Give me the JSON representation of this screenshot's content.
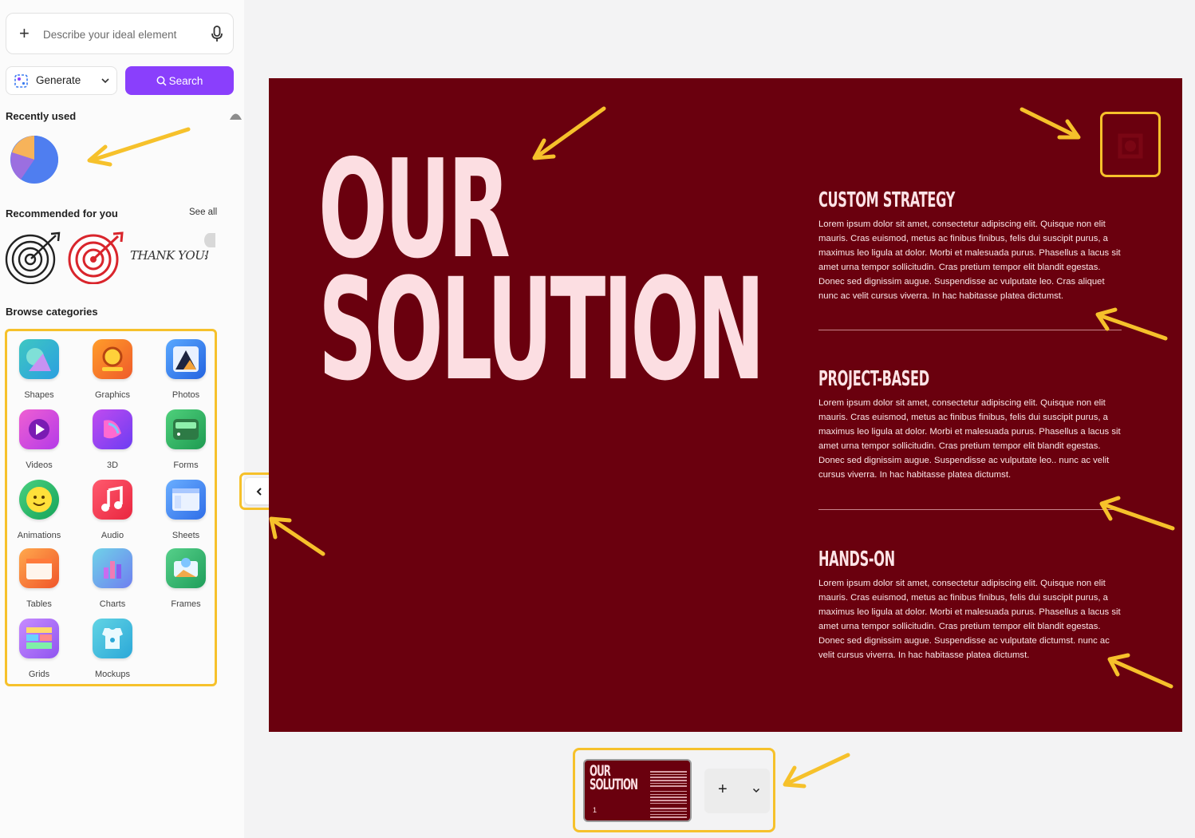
{
  "prompt": {
    "placeholder": "Describe your ideal element"
  },
  "toolbar": {
    "generate_label": "Generate",
    "search_label": "Search"
  },
  "recent": {
    "title": "Recently used"
  },
  "recommended": {
    "title": "Recommended for you",
    "see_all": "See all",
    "thank_you_text": "THANK YOU!"
  },
  "browse": {
    "title": "Browse categories",
    "categories": [
      {
        "label": "Shapes",
        "icon": "shapes-icon"
      },
      {
        "label": "Graphics",
        "icon": "graphics-icon"
      },
      {
        "label": "Photos",
        "icon": "photos-icon"
      },
      {
        "label": "Videos",
        "icon": "videos-icon"
      },
      {
        "label": "3D",
        "icon": "3d-icon"
      },
      {
        "label": "Forms",
        "icon": "forms-icon"
      },
      {
        "label": "Animations",
        "icon": "animations-icon"
      },
      {
        "label": "Audio",
        "icon": "audio-icon"
      },
      {
        "label": "Sheets",
        "icon": "sheets-icon"
      },
      {
        "label": "Tables",
        "icon": "tables-icon"
      },
      {
        "label": "Charts",
        "icon": "charts-icon"
      },
      {
        "label": "Frames",
        "icon": "frames-icon"
      },
      {
        "label": "Grids",
        "icon": "grids-icon"
      },
      {
        "label": "Mockups",
        "icon": "mockups-icon"
      }
    ]
  },
  "slide": {
    "title_line1": "OUR",
    "title_line2": "SOLUTION",
    "sections": [
      {
        "heading": "CUSTOM STRATEGY",
        "body": "Lorem ipsum dolor sit amet, consectetur adipiscing elit. Quisque non elit mauris. Cras euismod, metus ac finibus finibus, felis dui suscipit purus, a maximus leo ligula at dolor. Morbi et malesuada purus. Phasellus a lacus sit amet urna tempor sollicitudin. Cras pretium tempor elit blandit egestas. Donec sed dignissim augue. Suspendisse ac vulputate leo. Cras aliquet nunc ac velit cursus viverra. In hac habitasse platea dictumst."
      },
      {
        "heading": "PROJECT-BASED",
        "body": "Lorem ipsum dolor sit amet, consectetur adipiscing elit. Quisque non elit mauris. Cras euismod, metus ac finibus finibus, felis dui suscipit purus, a maximus leo ligula at dolor. Morbi et malesuada purus. Phasellus a lacus sit amet urna tempor sollicitudin. Cras pretium tempor elit blandit egestas. Donec sed dignissim augue. Suspendisse ac vulputate leo.. nunc ac velit cursus viverra. In hac habitasse platea dictumst."
      },
      {
        "heading": "HANDS-ON",
        "body": "Lorem ipsum dolor sit amet, consectetur adipiscing elit. Quisque non elit mauris. Cras euismod, metus ac finibus finibus, felis dui suscipit purus, a maximus leo ligula at dolor. Morbi et malesuada purus. Phasellus a lacus sit amet urna tempor sollicitudin. Cras pretium tempor elit blandit egestas. Donec sed dignissim augue. Suspendisse ac vulputate dictumst. nunc ac velit cursus viverra. In hac habitasse platea dictumst."
      }
    ]
  },
  "pages": {
    "thumb_title": "OUR\nSOLUTION",
    "thumb_number": "1",
    "add_label": "+"
  },
  "colors": {
    "accent": "#8a3ffc",
    "slide_bg": "#6a000e",
    "slide_text": "#fcdee2",
    "highlight": "#f6c12b"
  }
}
